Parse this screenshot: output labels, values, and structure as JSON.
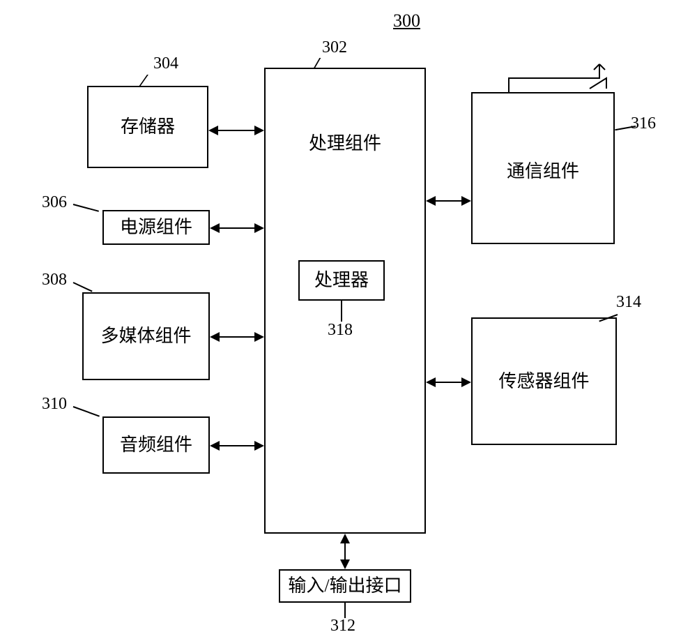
{
  "title": "300",
  "boxes": {
    "processing": {
      "label": "处理组件",
      "ref": "302"
    },
    "memory": {
      "label": "存储器",
      "ref": "304"
    },
    "power": {
      "label": "电源组件",
      "ref": "306"
    },
    "multimedia": {
      "label": "多媒体组件",
      "ref": "308"
    },
    "audio": {
      "label": "音频组件",
      "ref": "310"
    },
    "io": {
      "label": "输入/输出接口",
      "ref": "312"
    },
    "sensor": {
      "label": "传感器组件",
      "ref": "314"
    },
    "comm": {
      "label": "通信组件",
      "ref": "316"
    },
    "processor": {
      "label": "处理器",
      "ref": "318"
    }
  }
}
